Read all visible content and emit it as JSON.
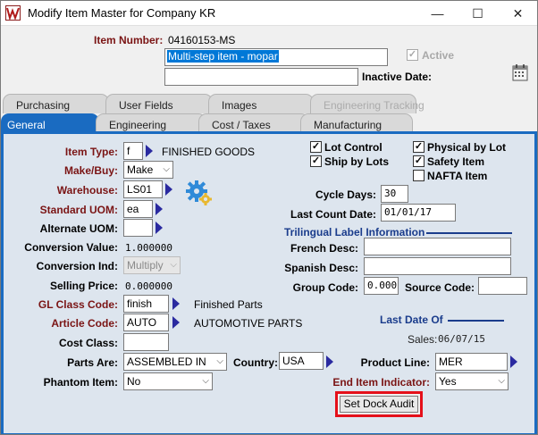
{
  "window": {
    "title": "Modify Item Master for Company KR",
    "minimize": "—",
    "maximize": "☐",
    "close": "✕"
  },
  "header": {
    "item_number_label": "Item Number:",
    "item_number": "04160153-MS",
    "description": "Multi-step item - mopar",
    "description2": "",
    "active_label": "Active",
    "active_checked": "✓",
    "inactive_date_label": "Inactive Date:",
    "inactive_date": ""
  },
  "tabs": {
    "top": [
      "Purchasing",
      "User Fields",
      "Images",
      "Engineering Tracking"
    ],
    "bottom": [
      "General",
      "Engineering",
      "Cost / Taxes",
      "Manufacturing"
    ]
  },
  "general": {
    "item_type_label": "Item Type:",
    "item_type": "f",
    "item_type_desc": "FINISHED GOODS",
    "make_buy_label": "Make/Buy:",
    "make_buy": "Make",
    "warehouse_label": "Warehouse:",
    "warehouse": "LS01",
    "standard_uom_label": "Standard UOM:",
    "standard_uom": "ea",
    "alternate_uom_label": "Alternate UOM:",
    "alternate_uom": "",
    "conversion_value_label": "Conversion Value:",
    "conversion_value": "1.000000",
    "conversion_ind_label": "Conversion Ind:",
    "conversion_ind": "Multiply",
    "selling_price_label": "Selling Price:",
    "selling_price": "0.000000",
    "gl_class_label": "GL Class Code:",
    "gl_class": "finish",
    "gl_class_desc": "Finished Parts",
    "article_code_label": "Article Code:",
    "article_code": "AUTO",
    "article_code_desc": "AUTOMOTIVE PARTS",
    "cost_class_label": "Cost Class:",
    "cost_class": "",
    "parts_are_label": "Parts Are:",
    "parts_are": "ASSEMBLED IN",
    "country_label": "Country:",
    "country": "USA",
    "product_line_label": "Product Line:",
    "product_line": "MER",
    "phantom_label": "Phantom Item:",
    "phantom": "No",
    "end_item_label": "End Item Indicator:",
    "end_item": "Yes"
  },
  "checks": {
    "lot_control": "Lot Control",
    "ship_by_lots": "Ship by Lots",
    "physical_by_lot": "Physical by Lot",
    "safety_item": "Safety Item",
    "nafta_item": "NAFTA Item",
    "mark": "✓"
  },
  "counts": {
    "cycle_days_label": "Cycle Days:",
    "cycle_days": "30",
    "last_count_date_label": "Last Count Date:",
    "last_count_date": "01/01/17"
  },
  "trilingual": {
    "heading": "Trilingual Label Information",
    "french_label": "French Desc:",
    "french": "",
    "spanish_label": "Spanish Desc:",
    "spanish": "",
    "group_code_label": "Group Code:",
    "group_code": "0.000",
    "source_code_label": "Source Code:",
    "source_code": ""
  },
  "last_date": {
    "heading": "Last Date Of",
    "sales_label": "Sales:",
    "sales": "06/07/15"
  },
  "buttons": {
    "set_dock_audit": "Set Dock Audit"
  },
  "colors": {
    "accent": "#1a6bc1",
    "label_red": "#7a1414",
    "highlight": "#e5101a",
    "selection": "#0078d7"
  }
}
